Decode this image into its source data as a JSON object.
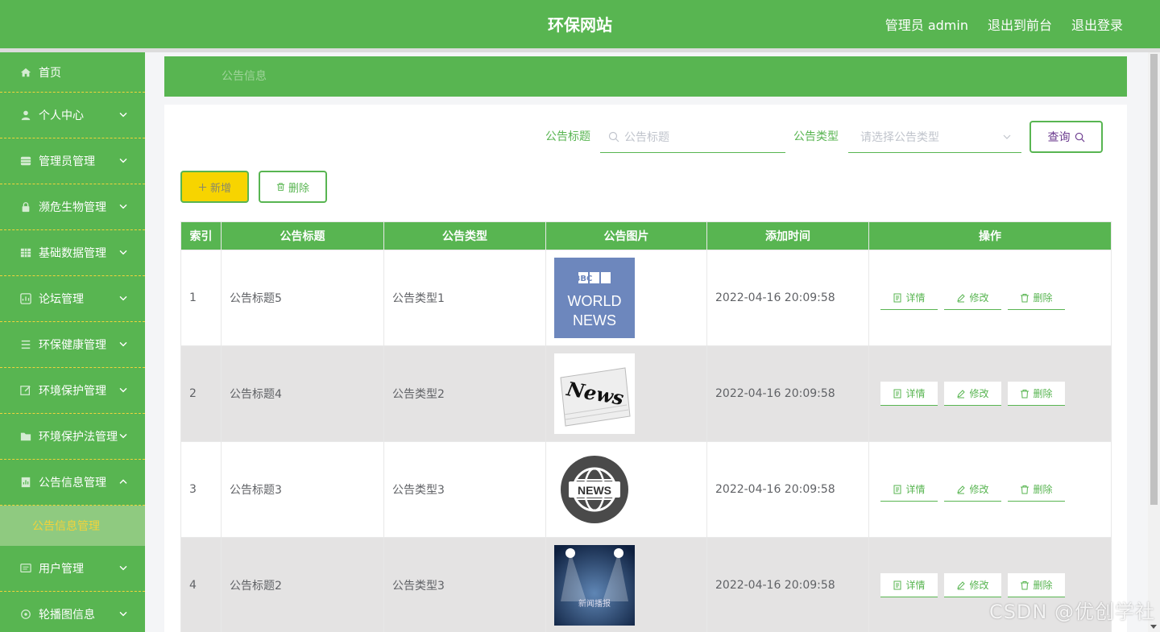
{
  "header": {
    "title": "环保网站",
    "links": [
      "管理员 admin",
      "退出到前台",
      "退出登录"
    ]
  },
  "sidebar": {
    "items": [
      {
        "label": "首页",
        "icon": "home-icon",
        "arrow": ""
      },
      {
        "label": "个人中心",
        "icon": "user-icon",
        "arrow": "down"
      },
      {
        "label": "管理员管理",
        "icon": "grid-icon",
        "arrow": "down"
      },
      {
        "label": "濒危生物管理",
        "icon": "lock-icon",
        "arrow": "down"
      },
      {
        "label": "基础数据管理",
        "icon": "table-icon",
        "arrow": "down"
      },
      {
        "label": "论坛管理",
        "icon": "chart-icon",
        "arrow": "down"
      },
      {
        "label": "环保健康管理",
        "icon": "list-icon",
        "arrow": "down"
      },
      {
        "label": "环境保护管理",
        "icon": "edit-icon",
        "arrow": "down"
      },
      {
        "label": "环境保护法管理",
        "icon": "folder-icon",
        "arrow": "down"
      },
      {
        "label": "公告信息管理",
        "icon": "report-icon",
        "arrow": "up"
      }
    ],
    "submenu": "公告信息管理",
    "items_after": [
      {
        "label": "用户管理",
        "icon": "message-icon",
        "arrow": "down"
      },
      {
        "label": "轮播图信息",
        "icon": "settings-icon",
        "arrow": "down"
      }
    ]
  },
  "breadcrumb": "公告信息",
  "search": {
    "title_label": "公告标题",
    "title_placeholder": "公告标题",
    "type_label": "公告类型",
    "type_placeholder": "请选择公告类型",
    "query_label": "查询"
  },
  "actions": {
    "add_label": "新增",
    "delete_label": "删除"
  },
  "table": {
    "columns": [
      "索引",
      "公告标题",
      "公告类型",
      "公告图片",
      "添加时间",
      "操作"
    ],
    "rows": [
      {
        "index": "1",
        "title": "公告标题5",
        "type": "公告类型1",
        "image": "bbc-world-news",
        "image_text": [
          "BBC",
          "WORLD",
          "NEWS"
        ],
        "time": "2022-04-16 20:09:58"
      },
      {
        "index": "2",
        "title": "公告标题4",
        "type": "公告类型2",
        "image": "newspaper-news",
        "image_text": [
          "News"
        ],
        "time": "2022-04-16 20:09:58"
      },
      {
        "index": "3",
        "title": "公告标题3",
        "type": "公告类型3",
        "image": "globe-news-badge",
        "image_text": [
          "NEWS"
        ],
        "time": "2022-04-16 20:09:58"
      },
      {
        "index": "4",
        "title": "公告标题2",
        "type": "公告类型3",
        "image": "spotlight-stage",
        "image_text": [
          "新闻播报"
        ],
        "time": "2022-04-16 20:09:58"
      }
    ],
    "row_actions": [
      "详情",
      "修改",
      "删除"
    ]
  },
  "watermark": "CSDN @优创学社",
  "colors": {
    "primary": "#58b551",
    "accent": "#f7d400",
    "row_alt": "#e4e3e3"
  }
}
